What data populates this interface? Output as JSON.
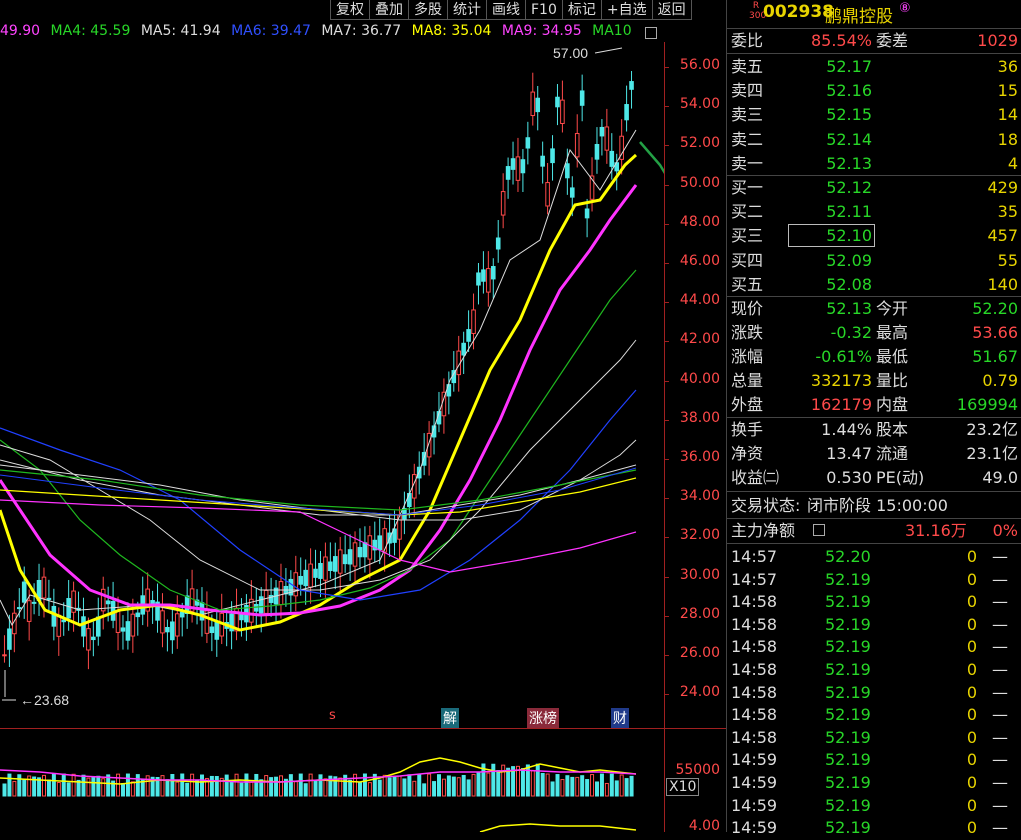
{
  "toolbar": [
    "复权",
    "叠加",
    "多股",
    "统计",
    "画线",
    "F10",
    "标记",
    "+自选",
    "返回"
  ],
  "ma_legend": [
    {
      "label": "49.90",
      "color": "#ff44ff"
    },
    {
      "label": "MA4: 45.59",
      "color": "#28d728"
    },
    {
      "label": "MA5: 41.94",
      "color": "#dddddd"
    },
    {
      "label": "MA6: 39.47",
      "color": "#3050ff"
    },
    {
      "label": "MA7: 36.77",
      "color": "#dddddd"
    },
    {
      "label": "MA8: 35.04",
      "color": "#ffff00"
    },
    {
      "label": "MA9: 34.95",
      "color": "#ff44ff"
    },
    {
      "label": "MA10",
      "color": "#28d728"
    }
  ],
  "price_axis": [
    "56.00",
    "54.00",
    "52.00",
    "50.00",
    "48.00",
    "46.00",
    "44.00",
    "42.00",
    "40.00",
    "38.00",
    "36.00",
    "34.00",
    "32.00",
    "30.00",
    "28.00",
    "26.00",
    "24.00"
  ],
  "high_marker": "57.00",
  "low_marker": "23.68",
  "event_tags": [
    "s",
    "解",
    "涨榜",
    "财"
  ],
  "volume_axis": {
    "top": "55000",
    "unit": "X10",
    "bottom": "4.00"
  },
  "stock": {
    "badge_top": "R",
    "badge_bottom": "300",
    "code": "002938",
    "name": "鹏鼎控股",
    "suffix": "⑧"
  },
  "weibi": {
    "label": "委比",
    "value": "85.54%",
    "label2": "委差",
    "value2": "1029"
  },
  "asks": [
    {
      "label": "卖五",
      "price": "52.17",
      "qty": "36"
    },
    {
      "label": "卖四",
      "price": "52.16",
      "qty": "15"
    },
    {
      "label": "卖三",
      "price": "52.15",
      "qty": "14"
    },
    {
      "label": "卖二",
      "price": "52.14",
      "qty": "18"
    },
    {
      "label": "卖一",
      "price": "52.13",
      "qty": "4"
    }
  ],
  "bids": [
    {
      "label": "买一",
      "price": "52.12",
      "qty": "429"
    },
    {
      "label": "买二",
      "price": "52.11",
      "qty": "35"
    },
    {
      "label": "买三",
      "price": "52.10",
      "qty": "457"
    },
    {
      "label": "买四",
      "price": "52.09",
      "qty": "55"
    },
    {
      "label": "买五",
      "price": "52.08",
      "qty": "140"
    }
  ],
  "quote": [
    {
      "l1": "现价",
      "v1": "52.13",
      "c1": "green",
      "l2": "今开",
      "v2": "52.20",
      "c2": "green"
    },
    {
      "l1": "涨跌",
      "v1": "-0.32",
      "c1": "green",
      "l2": "最高",
      "v2": "53.66",
      "c2": "red"
    },
    {
      "l1": "涨幅",
      "v1": "-0.61%",
      "c1": "green",
      "l2": "最低",
      "v2": "51.67",
      "c2": "green"
    },
    {
      "l1": "总量",
      "v1": "332173",
      "c1": "yellow",
      "l2": "量比",
      "v2": "0.79",
      "c2": "yellow"
    },
    {
      "l1": "外盘",
      "v1": "162179",
      "c1": "red",
      "l2": "内盘",
      "v2": "169994",
      "c2": "green"
    }
  ],
  "fund": [
    {
      "l1": "换手",
      "v1": "1.44%",
      "l2": "股本",
      "v2": "23.2亿"
    },
    {
      "l1": "净资",
      "v1": "13.47",
      "l2": "流通",
      "v2": "23.1亿"
    },
    {
      "l1": "收益㈡",
      "v1": "0.530",
      "l2": "PE(动)",
      "v2": "49.0"
    }
  ],
  "trade_state": {
    "label": "交易状态:",
    "value": "闭市阶段 15:00:00"
  },
  "main_flow": {
    "label": "主力净额",
    "value": "31.16万",
    "pct": "0%"
  },
  "ticks": [
    {
      "t": "14:57",
      "p": "52.20",
      "n": "0",
      "d": "—"
    },
    {
      "t": "14:57",
      "p": "52.19",
      "n": "0",
      "d": "—"
    },
    {
      "t": "14:58",
      "p": "52.19",
      "n": "0",
      "d": "—"
    },
    {
      "t": "14:58",
      "p": "52.19",
      "n": "0",
      "d": "—"
    },
    {
      "t": "14:58",
      "p": "52.19",
      "n": "0",
      "d": "—"
    },
    {
      "t": "14:58",
      "p": "52.19",
      "n": "0",
      "d": "—"
    },
    {
      "t": "14:58",
      "p": "52.19",
      "n": "0",
      "d": "—"
    },
    {
      "t": "14:58",
      "p": "52.19",
      "n": "0",
      "d": "—"
    },
    {
      "t": "14:58",
      "p": "52.19",
      "n": "0",
      "d": "—"
    },
    {
      "t": "14:59",
      "p": "52.19",
      "n": "0",
      "d": "—"
    },
    {
      "t": "14:59",
      "p": "52.19",
      "n": "0",
      "d": "—"
    },
    {
      "t": "14:59",
      "p": "52.19",
      "n": "0",
      "d": "—"
    },
    {
      "t": "14:59",
      "p": "52.19",
      "n": "0",
      "d": "—"
    }
  ],
  "colors": {
    "up": "#ff4a4a",
    "down": "#4ee8e8",
    "ma_yellow": "#ffff00",
    "ma_magenta": "#ff33ff",
    "ma_white": "#dddddd",
    "ma_green": "#1fb81f",
    "ma_blue": "#2040ff",
    "drawing": "#23a045"
  }
}
